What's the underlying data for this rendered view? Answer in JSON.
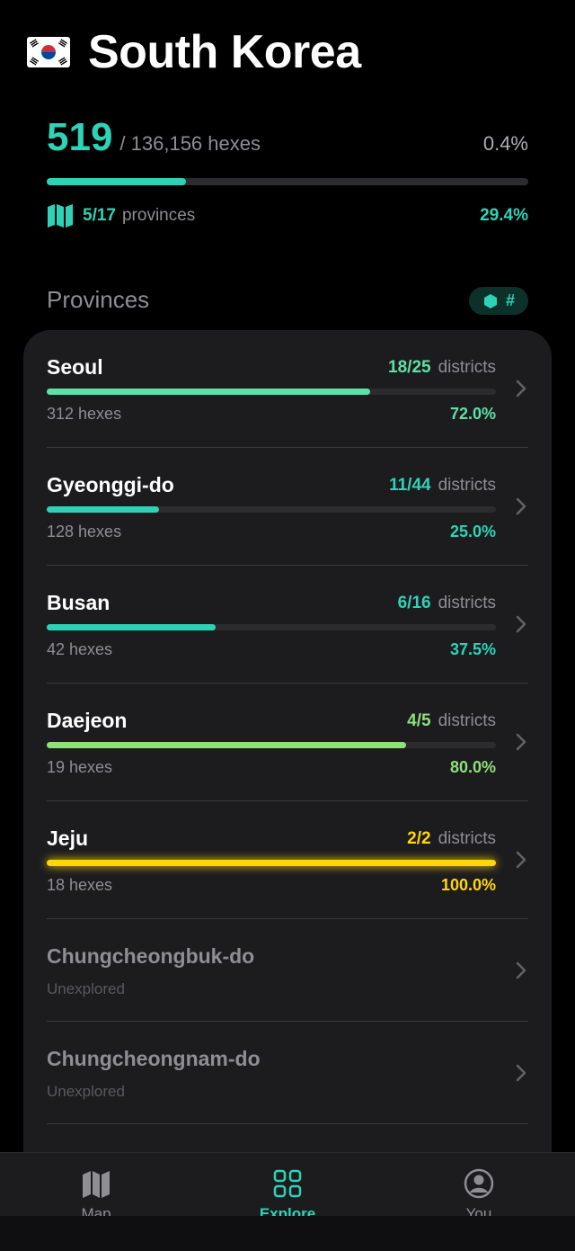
{
  "header": {
    "flag_icon": "south-korea-flag-icon",
    "title": "South Korea"
  },
  "summary": {
    "explored": "519",
    "total": "/ 136,156 hexes",
    "percent": "0.4%",
    "overall_progress": 0.29,
    "provinces_count": "5/17",
    "provinces_label": "provinces",
    "provinces_percent": "29.4%"
  },
  "provinces_section": {
    "title": "Provinces",
    "toggle_label": "#"
  },
  "colors": {
    "accent": "#2ed3b7",
    "mint": "#5fe0a6",
    "green": "#8de07a",
    "gold": "#ffd60a",
    "muted": "#8e8e93"
  },
  "provinces": [
    {
      "name": "Seoul",
      "districts": "18/25",
      "districts_word": "districts",
      "hexes": "312 hexes",
      "percent": "72.0%",
      "progress": 0.72,
      "color": "#5fe0a6"
    },
    {
      "name": "Gyeonggi-do",
      "districts": "11/44",
      "districts_word": "districts",
      "hexes": "128 hexes",
      "percent": "25.0%",
      "progress": 0.25,
      "color": "#2ed3b7"
    },
    {
      "name": "Busan",
      "districts": "6/16",
      "districts_word": "districts",
      "hexes": "42 hexes",
      "percent": "37.5%",
      "progress": 0.375,
      "color": "#2ed3b7"
    },
    {
      "name": "Daejeon",
      "districts": "4/5",
      "districts_word": "districts",
      "hexes": "19 hexes",
      "percent": "80.0%",
      "progress": 0.8,
      "color": "#8de07a"
    },
    {
      "name": "Jeju",
      "districts": "2/2",
      "districts_word": "districts",
      "hexes": "18 hexes",
      "percent": "100.0%",
      "progress": 1.0,
      "color": "#ffd60a"
    }
  ],
  "unexplored": [
    {
      "name": "Chungcheongbuk-do",
      "status": "Unexplored"
    },
    {
      "name": "Chungcheongnam-do",
      "status": "Unexplored"
    }
  ],
  "tabs": [
    {
      "label": "Map",
      "icon": "map-icon",
      "active": false
    },
    {
      "label": "Explore",
      "icon": "grid-icon",
      "active": true
    },
    {
      "label": "You",
      "icon": "profile-icon",
      "active": false
    }
  ]
}
